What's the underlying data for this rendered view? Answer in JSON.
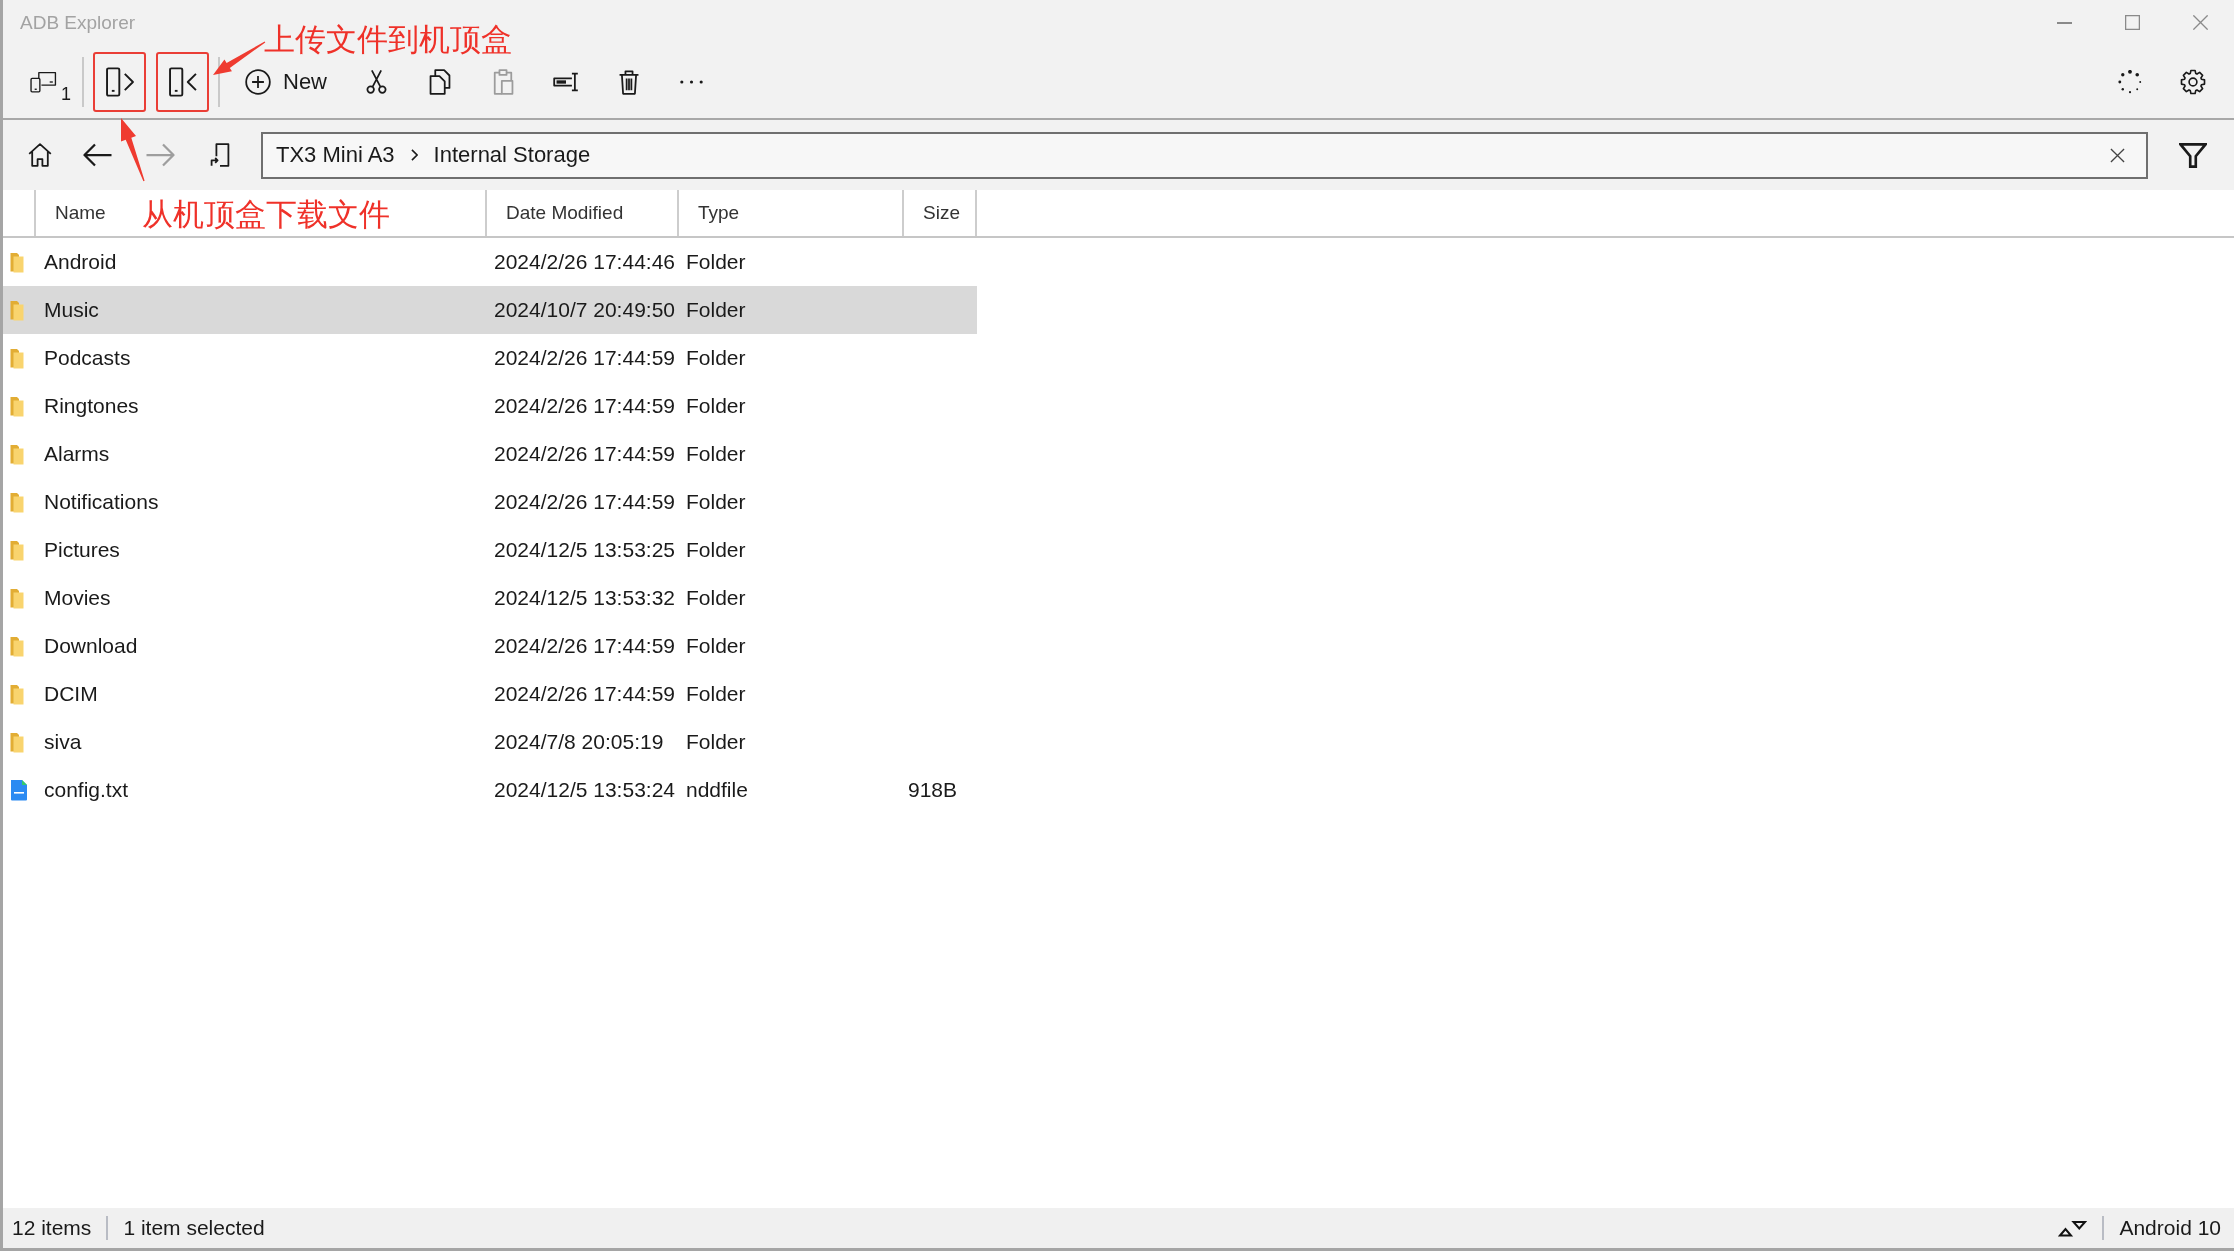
{
  "window": {
    "title": "ADB Explorer"
  },
  "toolbar": {
    "groups": [
      [
        {
          "kind": "devices",
          "badge": "1",
          "disabled": false,
          "highlighted": false
        }
      ],
      [
        {
          "kind": "pull",
          "disabled": false,
          "highlighted": true
        },
        {
          "kind": "push",
          "disabled": false,
          "highlighted": true
        }
      ],
      [
        {
          "kind": "new",
          "label": "New",
          "disabled": false,
          "highlighted": false
        },
        {
          "kind": "cut",
          "disabled": false,
          "highlighted": false
        },
        {
          "kind": "copy",
          "disabled": false,
          "highlighted": false
        },
        {
          "kind": "paste",
          "disabled": true,
          "highlighted": false
        },
        {
          "kind": "rename",
          "disabled": false,
          "highlighted": false
        },
        {
          "kind": "delete",
          "disabled": false,
          "highlighted": false
        },
        {
          "kind": "more",
          "disabled": false,
          "highlighted": false
        }
      ]
    ],
    "right": [
      {
        "kind": "progress"
      },
      {
        "kind": "settings"
      }
    ]
  },
  "annotations": [
    {
      "kind": "push",
      "text": "上传文件到机顶盒"
    },
    {
      "kind": "pull",
      "text": "从机顶盒下载文件"
    }
  ],
  "navigation": {
    "buttons": [
      {
        "kind": "home",
        "disabled": false
      },
      {
        "kind": "back",
        "disabled": false
      },
      {
        "kind": "forward",
        "disabled": true
      },
      {
        "kind": "up",
        "disabled": false
      }
    ],
    "path": [
      "TX3 Mini A3",
      "Internal Storage"
    ]
  },
  "table": {
    "columns": [
      "Name",
      "Date Modified",
      "Type",
      "Size"
    ],
    "rows": [
      {
        "name": "Android",
        "modified": "2024/2/26 17:44:46",
        "type": "Folder",
        "kind": "folder",
        "selected": false
      },
      {
        "name": "Music",
        "modified": "2024/10/7 20:49:50",
        "type": "Folder",
        "kind": "folder",
        "selected": true
      },
      {
        "name": "Podcasts",
        "modified": "2024/2/26 17:44:59",
        "type": "Folder",
        "kind": "folder",
        "selected": false
      },
      {
        "name": "Ringtones",
        "modified": "2024/2/26 17:44:59",
        "type": "Folder",
        "kind": "folder",
        "selected": false
      },
      {
        "name": "Alarms",
        "modified": "2024/2/26 17:44:59",
        "type": "Folder",
        "kind": "folder",
        "selected": false
      },
      {
        "name": "Notifications",
        "modified": "2024/2/26 17:44:59",
        "type": "Folder",
        "kind": "folder",
        "selected": false
      },
      {
        "name": "Pictures",
        "modified": "2024/12/5 13:53:25",
        "type": "Folder",
        "kind": "folder",
        "selected": false
      },
      {
        "name": "Movies",
        "modified": "2024/12/5 13:53:32",
        "type": "Folder",
        "kind": "folder",
        "selected": false
      },
      {
        "name": "Download",
        "modified": "2024/2/26 17:44:59",
        "type": "Folder",
        "kind": "folder",
        "selected": false
      },
      {
        "name": "DCIM",
        "modified": "2024/2/26 17:44:59",
        "type": "Folder",
        "kind": "folder",
        "selected": false
      },
      {
        "name": "siva",
        "modified": "2024/7/8 20:05:19",
        "type": "Folder",
        "kind": "folder",
        "selected": false
      },
      {
        "name": "config.txt",
        "modified": "2024/12/5 13:53:24",
        "type": "nddfile",
        "size": "918B",
        "kind": "file",
        "selected": false
      }
    ]
  },
  "status_bar": {
    "item_count": "12 items",
    "selection": "1 item selected",
    "platform": "Android 10"
  }
}
